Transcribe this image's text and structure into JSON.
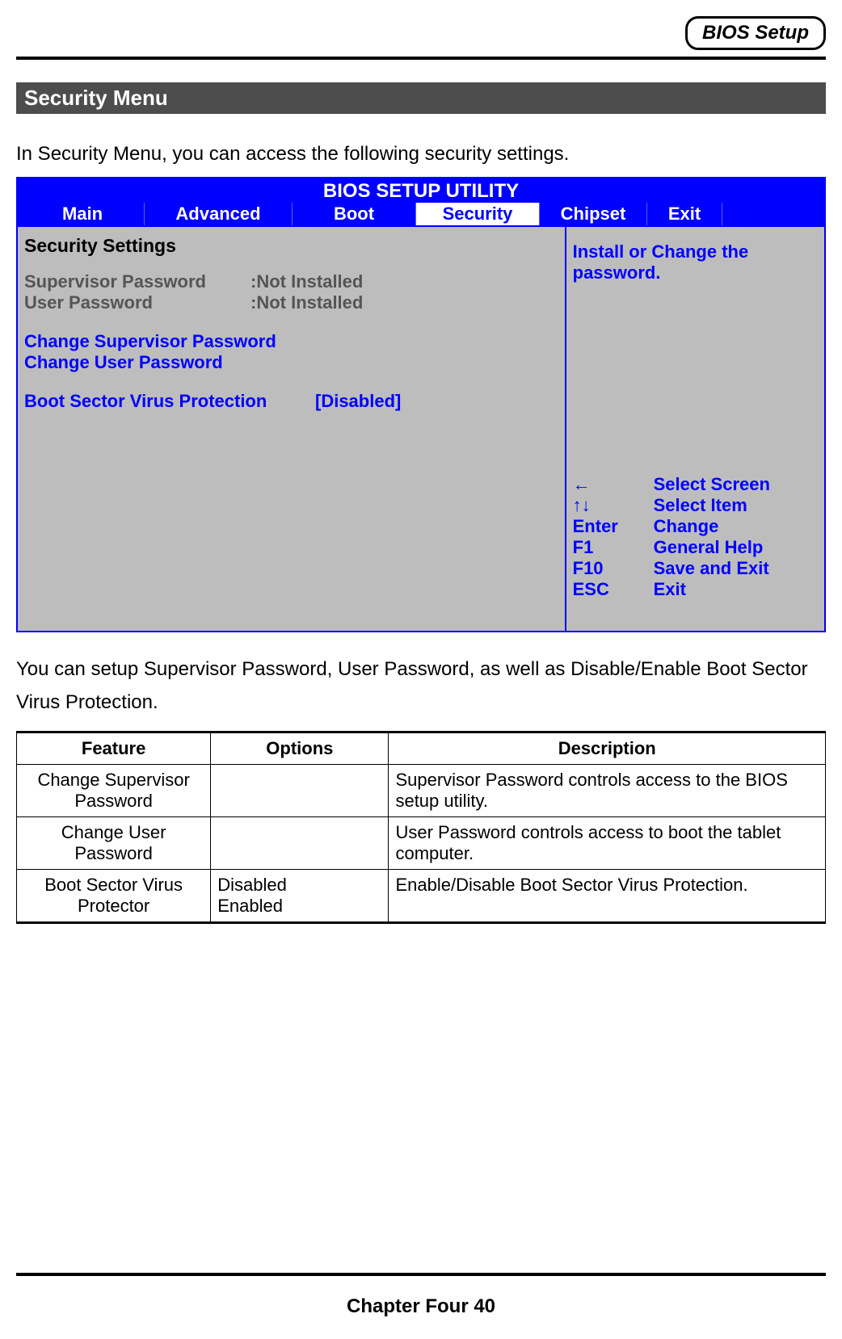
{
  "header": {
    "badge": "BIOS Setup",
    "section_title": "Security Menu",
    "intro": "In Security Menu, you can access the following security settings."
  },
  "bios": {
    "title": "BIOS SETUP UTILITY",
    "tabs": {
      "main": "Main",
      "advanced": "Advanced",
      "boot": "Boot",
      "security": "Security",
      "chipset": "Chipset",
      "exit": "Exit"
    },
    "left": {
      "heading": "Security Settings",
      "supervisor_label": "Supervisor Password",
      "supervisor_value": ":Not Installed",
      "user_label": "User Password",
      "user_value": ":Not Installed",
      "change_supervisor": "Change Supervisor Password",
      "change_user": "Change User Password",
      "bootsector_label": "Boot Sector Virus Protection",
      "bootsector_value": "[Disabled]"
    },
    "right": {
      "help": "Install or Change the password.",
      "keys": [
        {
          "key": "←",
          "action": "Select Screen"
        },
        {
          "key": "↑↓",
          "action": "Select Item"
        },
        {
          "key": "Enter",
          "action": "Change"
        },
        {
          "key": "F1",
          "action": "General Help"
        },
        {
          "key": "F10",
          "action": "Save and Exit"
        },
        {
          "key": "ESC",
          "action": "Exit"
        }
      ]
    }
  },
  "below_text": "You can setup Supervisor Password, User Password, as well as Disable/Enable Boot Sector Virus Protection.",
  "table": {
    "headers": {
      "feature": "Feature",
      "options": "Options",
      "description": "Description"
    },
    "rows": [
      {
        "feature": "Change Supervisor Password",
        "options": "",
        "description": "Supervisor Password controls access to the BIOS setup utility."
      },
      {
        "feature": "Change User Password",
        "options": "",
        "description": "User Password controls access to boot the tablet computer."
      },
      {
        "feature": "Boot Sector Virus Protector",
        "options": "Disabled\nEnabled",
        "description": "Enable/Disable Boot Sector Virus Protection."
      }
    ]
  },
  "footer": "Chapter Four 40"
}
